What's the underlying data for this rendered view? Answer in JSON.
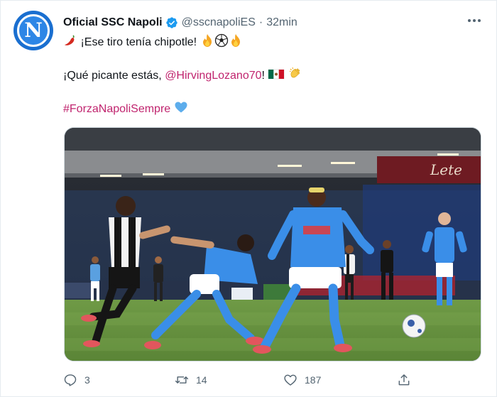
{
  "tweet": {
    "author_name": "Oficial SSC Napoli",
    "handle": "@sscnapoliES",
    "separator": "·",
    "time": "32min",
    "avatar_letter": "N",
    "line1": "¡Ese tiro tenía chipotle!",
    "line2_prefix": "¡Qué picante estás, ",
    "mention": "@HirvingLozano70",
    "line2_suffix": "!",
    "hashtag": "#ForzaNapoliSempre",
    "sponsor_banner": "Lete",
    "colors": {
      "link": "#c0246e",
      "verified": "#1d9bf0",
      "secondary_text": "#536471",
      "napoli_blue": "#1a6fd0"
    }
  },
  "actions": {
    "reply_count": "3",
    "retweet_count": "14",
    "like_count": "187",
    "icons": [
      "reply-icon",
      "retweet-icon",
      "like-icon",
      "share-icon"
    ]
  }
}
